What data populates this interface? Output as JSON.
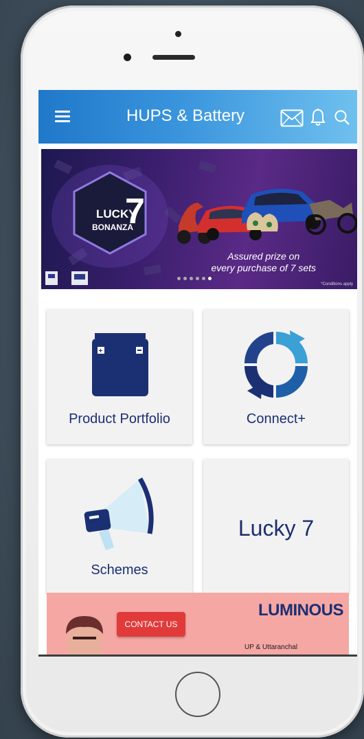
{
  "header": {
    "title": "HUPS & Battery"
  },
  "banner": {
    "logo_top": "LUCKY",
    "logo_number": "7",
    "logo_bottom": "BONANZA",
    "caption_line1": "Assured prize on",
    "caption_line2": "every purchase of 7 sets",
    "note": "*Conditions apply",
    "dot_count": 6,
    "active_dot": 5
  },
  "tiles": [
    {
      "label": "Product Portfolio",
      "icon": "battery-icon"
    },
    {
      "label": "Connect+",
      "icon": "refresh-icon"
    },
    {
      "label": "Schemes",
      "icon": "megaphone-icon"
    },
    {
      "label": "Lucky 7",
      "icon": ""
    }
  ],
  "contact_banner": {
    "button_label": "CONTACT US",
    "brand": "LUMINOUS",
    "region": "UP & Uttaranchal"
  },
  "colors": {
    "header_start": "#1f78c9",
    "header_end": "#6fc0ee",
    "tile_text": "#1b2f73",
    "contact_bg": "#f5a7a3",
    "contact_button": "#e23a3a"
  }
}
